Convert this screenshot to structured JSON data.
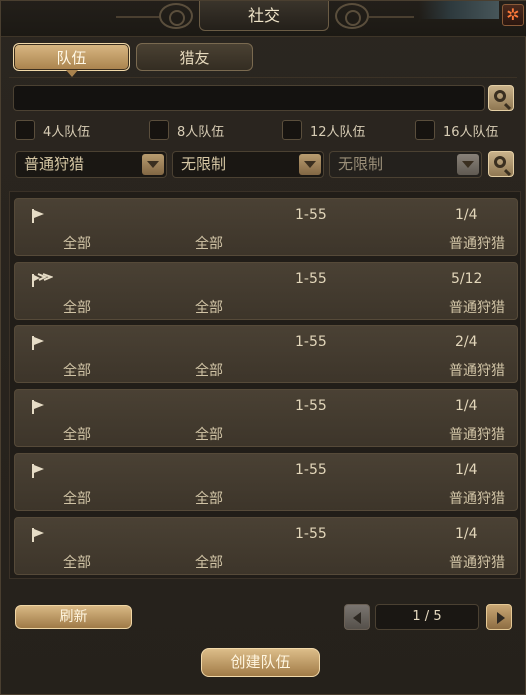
{
  "window": {
    "title": "社交",
    "close_glyph": "✲"
  },
  "tabs": [
    {
      "label": "队伍",
      "active": true
    },
    {
      "label": "猎友",
      "active": false
    }
  ],
  "search": {
    "value": "",
    "placeholder": ""
  },
  "filters": {
    "checkboxes": [
      {
        "label": "4人队伍",
        "checked": false
      },
      {
        "label": "8人队伍",
        "checked": false
      },
      {
        "label": "12人队伍",
        "checked": false
      },
      {
        "label": "16人队伍",
        "checked": false
      }
    ],
    "dropdowns": [
      {
        "value": "普通狩猎"
      },
      {
        "value": "无限制"
      },
      {
        "value": "无限制"
      }
    ]
  },
  "teams": [
    {
      "icon": "single-flag-icon",
      "level": "1-55",
      "members": "1/4",
      "col_a": "全部",
      "col_b": "全部",
      "mode": "普通狩猎"
    },
    {
      "icon": "multi-flag-icon",
      "level": "1-55",
      "members": "5/12",
      "col_a": "全部",
      "col_b": "全部",
      "mode": "普通狩猎"
    },
    {
      "icon": "single-flag-icon",
      "level": "1-55",
      "members": "2/4",
      "col_a": "全部",
      "col_b": "全部",
      "mode": "普通狩猎"
    },
    {
      "icon": "single-flag-icon",
      "level": "1-55",
      "members": "1/4",
      "col_a": "全部",
      "col_b": "全部",
      "mode": "普通狩猎"
    },
    {
      "icon": "single-flag-icon",
      "level": "1-55",
      "members": "1/4",
      "col_a": "全部",
      "col_b": "全部",
      "mode": "普通狩猎"
    },
    {
      "icon": "single-flag-icon",
      "level": "1-55",
      "members": "1/4",
      "col_a": "全部",
      "col_b": "全部",
      "mode": "普通狩猎"
    }
  ],
  "footer": {
    "refresh_label": "刷新",
    "page_indicator": "1 / 5",
    "create_label": "创建队伍"
  }
}
